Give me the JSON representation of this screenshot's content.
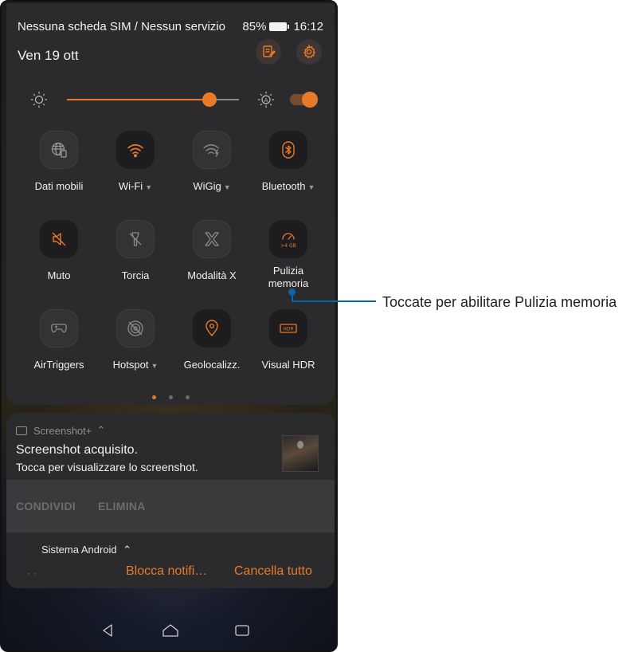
{
  "status_bar": {
    "carrier": "Nessuna scheda SIM / Nessun servizio",
    "battery_percent": "85%",
    "time": "16:12"
  },
  "header": {
    "date": "Ven 19 ott",
    "edit_icon": "edit-icon",
    "settings_icon": "gear-icon"
  },
  "brightness": {
    "level_percent": 82,
    "auto_enabled": true,
    "auto_icon_letter": "A"
  },
  "tiles": [
    {
      "label": "Dati mobili",
      "icon": "globe-icon",
      "active": false,
      "has_menu": false
    },
    {
      "label": "Wi-Fi",
      "icon": "wifi-icon",
      "active": true,
      "has_menu": true
    },
    {
      "label": "WiGig",
      "icon": "wigig-icon",
      "active": false,
      "has_menu": true
    },
    {
      "label": "Bluetooth",
      "icon": "bluetooth-icon",
      "active": true,
      "has_menu": true
    },
    {
      "label": "Muto",
      "icon": "mute-icon",
      "active": true,
      "has_menu": false
    },
    {
      "label": "Torcia",
      "icon": "flashlight-icon",
      "active": false,
      "has_menu": false
    },
    {
      "label": "Modalità X",
      "icon": "x-mode-icon",
      "active": false,
      "has_menu": false
    },
    {
      "label": "Pulizia memoria",
      "icon": "memory-cleanup-icon",
      "active": true,
      "has_menu": false,
      "badge": ">4 GB"
    },
    {
      "label": "AirTriggers",
      "icon": "gamepad-icon",
      "active": false,
      "has_menu": false
    },
    {
      "label": "Hotspot",
      "icon": "hotspot-icon",
      "active": false,
      "has_menu": true
    },
    {
      "label": "Geolocalizz.",
      "icon": "location-pin-icon",
      "active": true,
      "has_menu": false
    },
    {
      "label": "Visual HDR",
      "icon": "hdr-icon",
      "active": true,
      "has_menu": false,
      "badge": "HDR"
    }
  ],
  "page_dots": {
    "count": 3,
    "active": 0
  },
  "notification": {
    "app_name": "Screenshot+",
    "title": "Screenshot acquisito.",
    "text": "Tocca per visualizzare lo screenshot.",
    "actions": [
      "CONDIVIDI",
      "ELIMINA"
    ]
  },
  "system_row": {
    "title": "Sistema Android",
    "placeholder_dots": "· ·",
    "block_button": "Blocca notifi…",
    "clear_button": "Cancella tutto"
  },
  "nav": {
    "back_icon": "back-icon",
    "home_icon": "home-icon",
    "recents_icon": "recents-icon"
  },
  "callout": {
    "text": "Toccate per abilitare Pulizia memoria"
  },
  "colors": {
    "accent": "#e87a2a",
    "panel": "#2b2b2d",
    "callout": "#0b64a8"
  }
}
